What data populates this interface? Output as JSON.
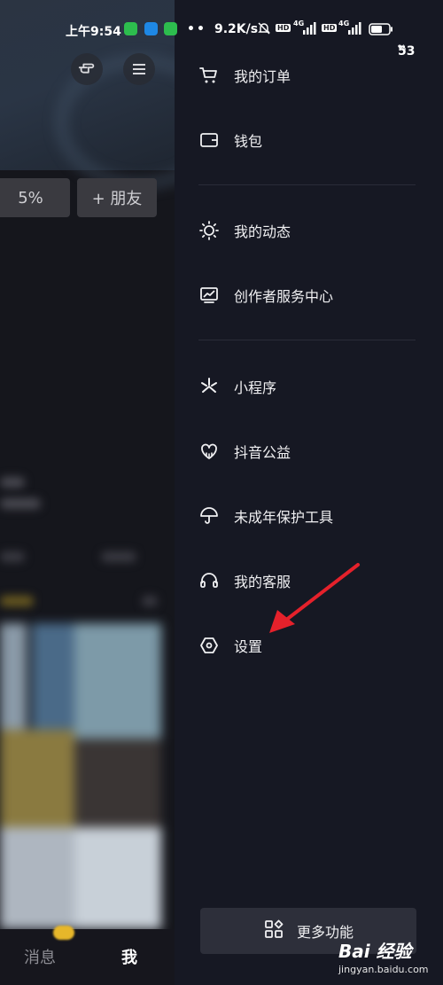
{
  "status_bar": {
    "time": "上午9:54",
    "dots": "••",
    "net_speed": "9.2K/s",
    "hd1": "HD",
    "net1": "4G",
    "hd2": "HD",
    "net2": "4G",
    "battery": "53"
  },
  "profile_bg": {
    "percent_text": "5%",
    "add_friend": "+ 朋友",
    "tabs": {
      "messages": "消息",
      "me": "我"
    }
  },
  "drawer": {
    "items": [
      {
        "label": "我的订单",
        "icon": "cart-icon"
      },
      {
        "label": "钱包",
        "icon": "wallet-icon"
      },
      {
        "label": "我的动态",
        "icon": "sun-icon"
      },
      {
        "label": "创作者服务中心",
        "icon": "chart-monitor-icon"
      },
      {
        "label": "小程序",
        "icon": "asterisk-icon"
      },
      {
        "label": "抖音公益",
        "icon": "heart-cloud-icon"
      },
      {
        "label": "未成年保护工具",
        "icon": "umbrella-icon"
      },
      {
        "label": "我的客服",
        "icon": "headset-icon"
      },
      {
        "label": "设置",
        "icon": "hexagon-settings-icon"
      }
    ],
    "more_button": {
      "label": "更多功能",
      "icon": "grid-shapes-icon"
    }
  },
  "annotation_color": "#e5212b",
  "watermark": {
    "main": "Bai 经验",
    "sub": "jingyan.baidu.com"
  }
}
